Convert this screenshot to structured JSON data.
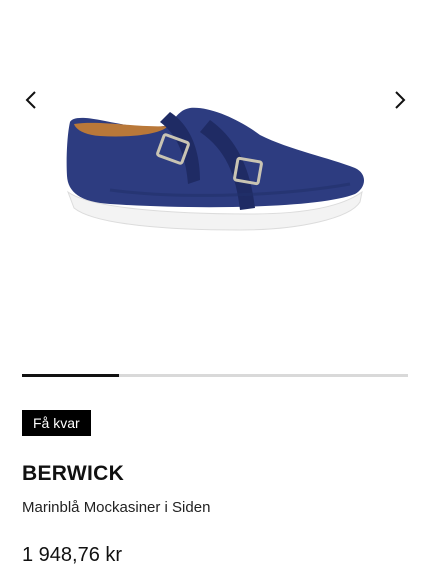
{
  "gallery": {
    "image_alt": "Marinblå Mockasiner i Siden",
    "prev_icon": "chevron-left-icon",
    "next_icon": "chevron-right-icon",
    "progress_fraction": 0.25,
    "colors": {
      "shoe_suede": "#2b3a7e",
      "sole": "#f2f2f2",
      "lining": "#b8753a",
      "buckle": "#c9c4b3"
    }
  },
  "badge": {
    "label": "Få kvar"
  },
  "product": {
    "brand": "BERWICK",
    "name": "Marinblå Mockasiner i Siden",
    "price": "1 948,76 kr"
  }
}
